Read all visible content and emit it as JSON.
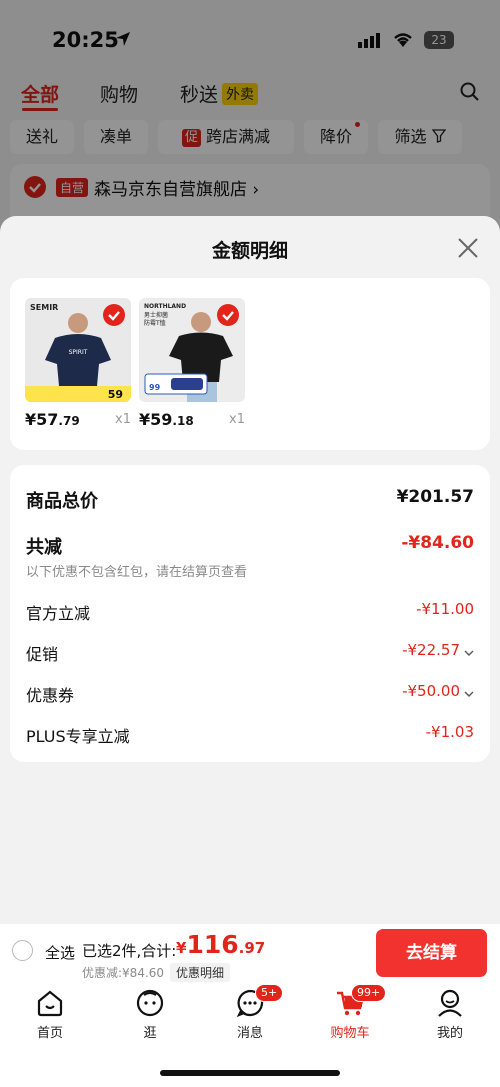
{
  "status": {
    "time": "20:25",
    "battery": "23"
  },
  "topnav": {
    "all": "全部",
    "shopping": "购物",
    "express": "秒送",
    "takeout": "外卖"
  },
  "chips": {
    "gift": "送礼",
    "combine": "凑单",
    "promo_tag": "促",
    "cross_store": "跨店满减",
    "price_drop": "降价",
    "filter": "筛选"
  },
  "store": {
    "self_tag": "自营",
    "name": "森马京东自营旗舰店 ›"
  },
  "sheet": {
    "title": "金额明细"
  },
  "products": [
    {
      "brand": "SEMIR",
      "price_int": "¥57",
      "price_dec": ".79",
      "qty": "x1",
      "footer_price": "59"
    },
    {
      "brand": "NORTHLAND",
      "tagline": "男士抑菌 防霉T恤",
      "price_int": "¥59",
      "price_dec": ".18",
      "qty": "x1",
      "badge": "99"
    }
  ],
  "details": {
    "subtotal_label": "商品总价",
    "subtotal_value": "¥201.57",
    "discount_label": "共减",
    "discount_value": "-¥84.60",
    "note": "以下优惠不包含红包，请在结算页查看",
    "items": [
      {
        "label": "官方立减",
        "value": "-¥11.00",
        "chevron": false
      },
      {
        "label": "促销",
        "value": "-¥22.57",
        "chevron": true
      },
      {
        "label": "优惠券",
        "value": "-¥50.00",
        "chevron": true
      },
      {
        "label": "PLUS专享立减",
        "value": "-¥1.03",
        "chevron": false
      }
    ]
  },
  "checkout": {
    "select_all": "全选",
    "selected": "已选2件,合计:",
    "total_symbol": "¥",
    "total_int": "116",
    "total_dec": ".97",
    "saved": "优惠减:¥84.60",
    "detail_button": "优惠明细",
    "pay_button": "去结算"
  },
  "tabbar": {
    "home": "首页",
    "browse": "逛",
    "messages": "消息",
    "messages_badge": "5+",
    "cart": "购物车",
    "cart_badge": "99+",
    "me": "我的"
  },
  "colors": {
    "accent": "#e1251b"
  }
}
